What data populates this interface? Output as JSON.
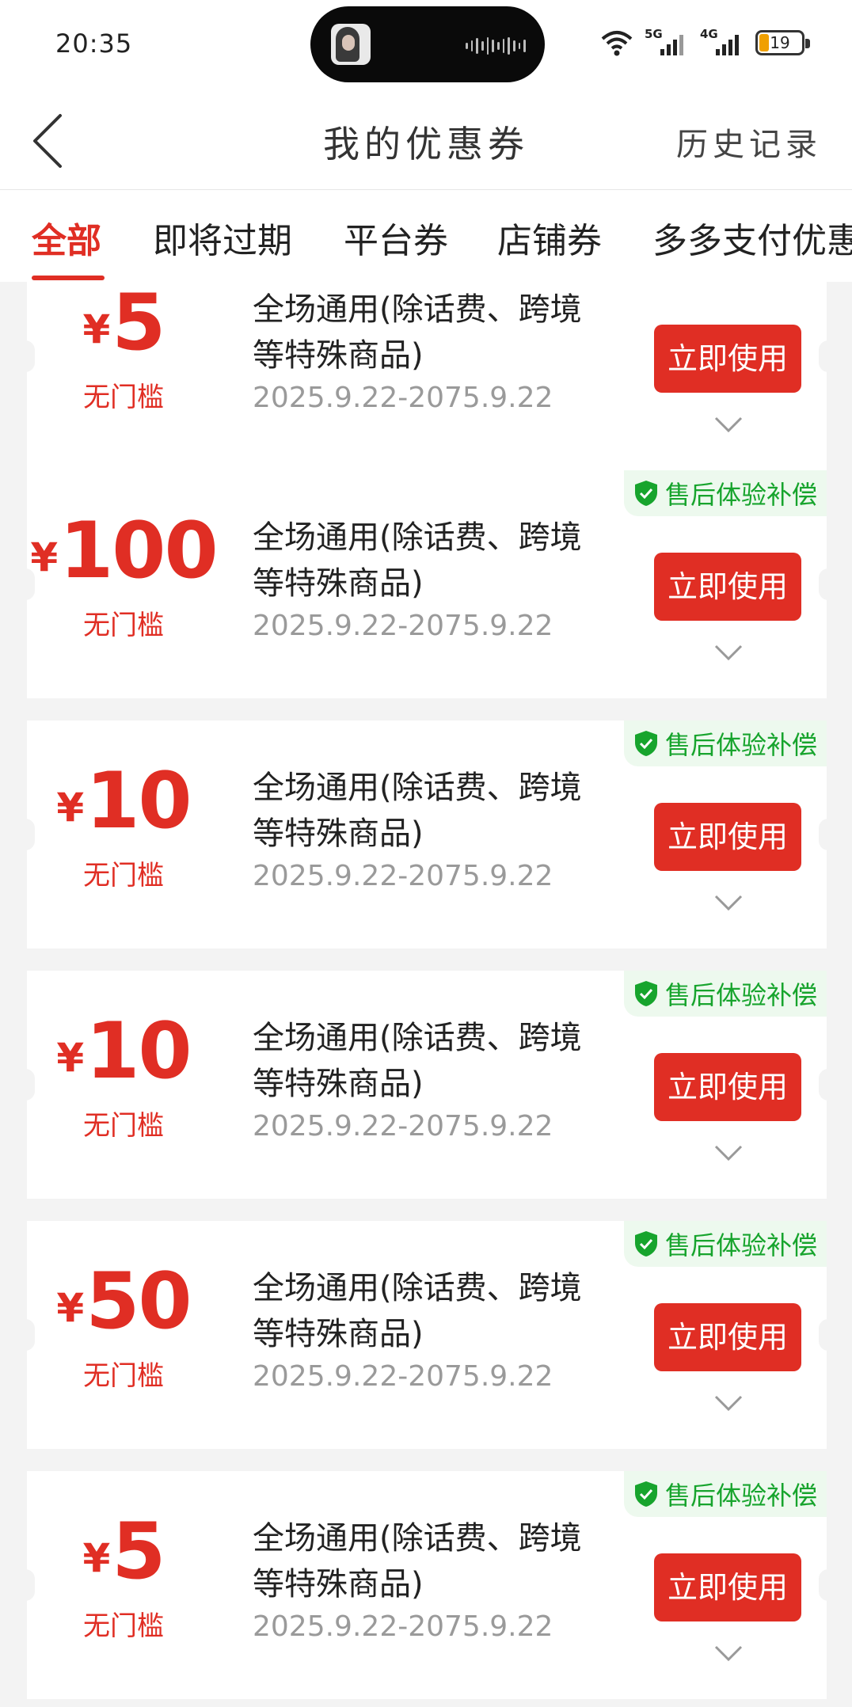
{
  "status": {
    "time": "20:35",
    "net1": "5G",
    "net2": "4G",
    "battery": "19"
  },
  "header": {
    "title": "我的优惠券",
    "history": "历史记录"
  },
  "tabs": [
    {
      "label": "全部",
      "active": true
    },
    {
      "label": "即将过期",
      "active": false
    },
    {
      "label": "平台券",
      "active": false
    },
    {
      "label": "店铺券",
      "active": false
    },
    {
      "label": "多多支付优惠",
      "active": false
    }
  ],
  "coupons": [
    {
      "currency": "¥",
      "amount": "5",
      "threshold": "无门槛",
      "description": "全场通用(除话费、跨境等特殊商品)",
      "validity": "2025.9.22-2075.9.22",
      "badge": "",
      "button": "立即使用"
    },
    {
      "currency": "¥",
      "amount": "100",
      "threshold": "无门槛",
      "description": "全场通用(除话费、跨境等特殊商品)",
      "validity": "2025.9.22-2075.9.22",
      "badge": "售后体验补偿",
      "button": "立即使用"
    },
    {
      "currency": "¥",
      "amount": "10",
      "threshold": "无门槛",
      "description": "全场通用(除话费、跨境等特殊商品)",
      "validity": "2025.9.22-2075.9.22",
      "badge": "售后体验补偿",
      "button": "立即使用"
    },
    {
      "currency": "¥",
      "amount": "10",
      "threshold": "无门槛",
      "description": "全场通用(除话费、跨境等特殊商品)",
      "validity": "2025.9.22-2075.9.22",
      "badge": "售后体验补偿",
      "button": "立即使用"
    },
    {
      "currency": "¥",
      "amount": "50",
      "threshold": "无门槛",
      "description": "全场通用(除话费、跨境等特殊商品)",
      "validity": "2025.9.22-2075.9.22",
      "badge": "售后体验补偿",
      "button": "立即使用"
    },
    {
      "currency": "¥",
      "amount": "5",
      "threshold": "无门槛",
      "description": "全场通用(除话费、跨境等特殊商品)",
      "validity": "2025.9.22-2075.9.22",
      "badge": "售后体验补偿",
      "button": "立即使用"
    }
  ],
  "colors": {
    "accent": "#e02e24",
    "badge_text": "#17a42d",
    "badge_bg": "#edf9ee",
    "page_bg": "#f3f3f3"
  }
}
